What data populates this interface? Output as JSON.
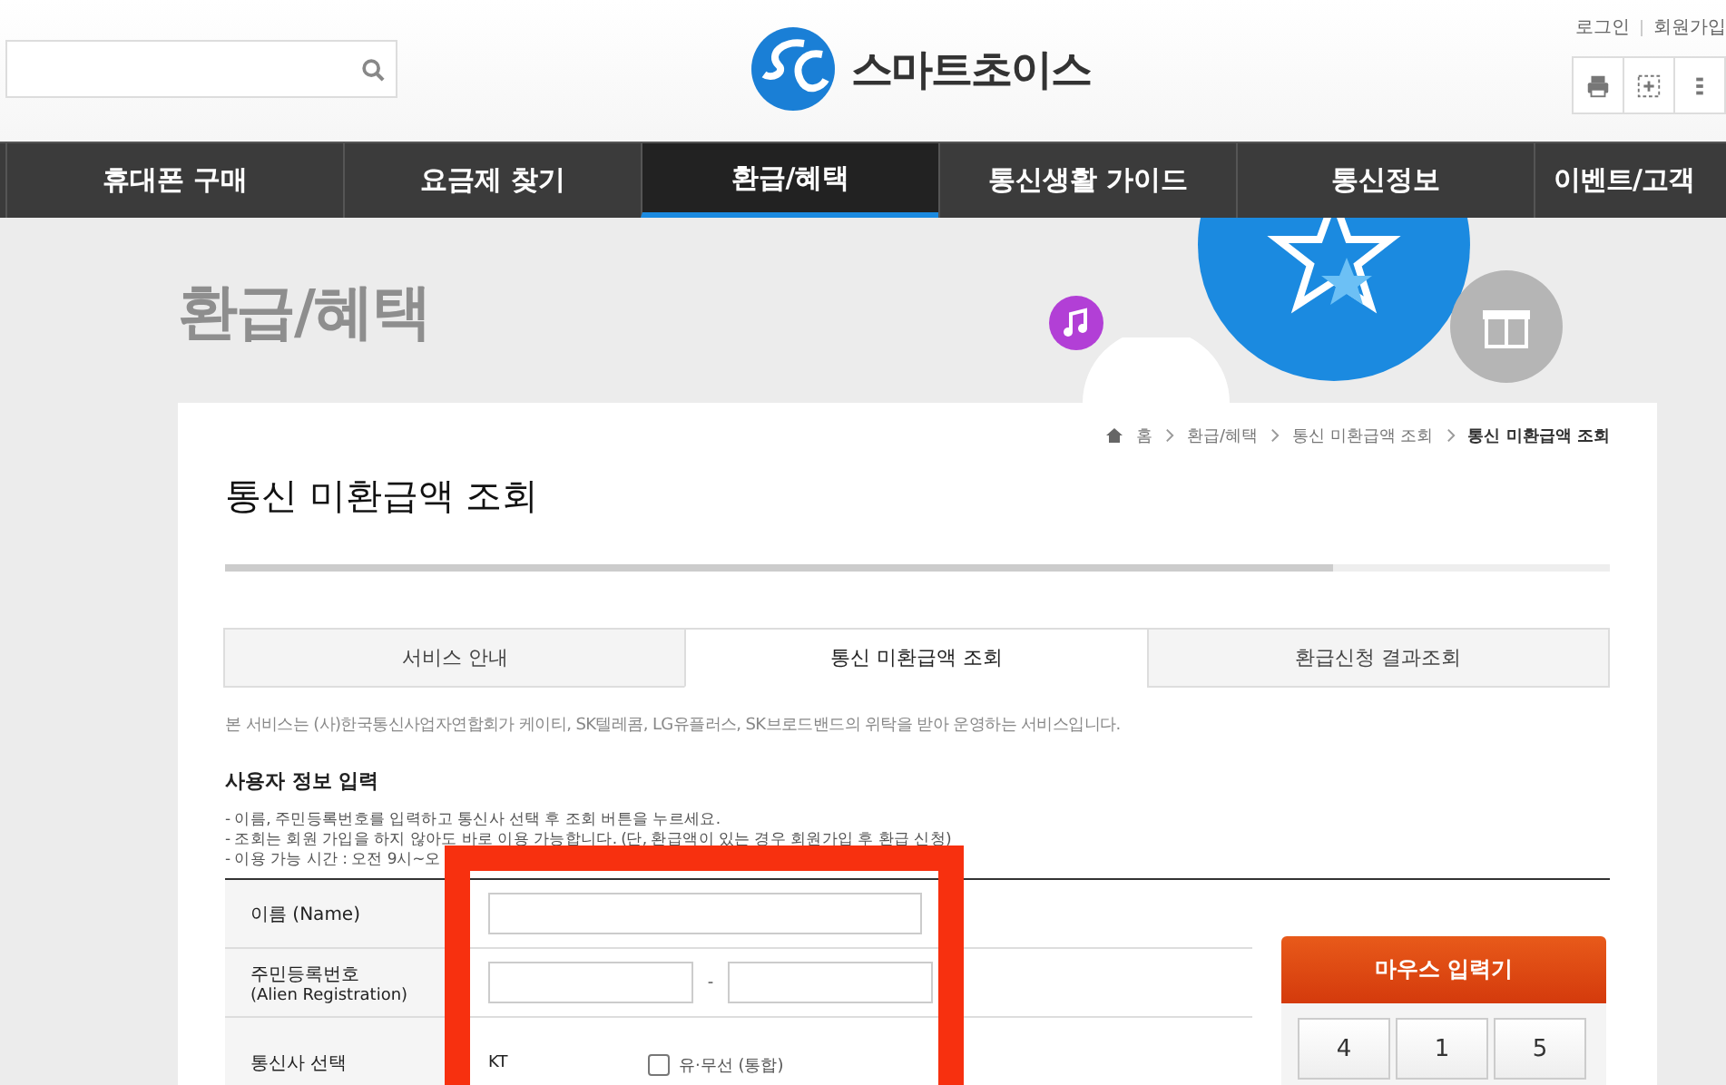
{
  "header": {
    "logo_text": "스마트초이스",
    "links": [
      "로그인",
      "회원가입"
    ]
  },
  "nav": [
    {
      "label": "휴대폰 구매",
      "selected": false
    },
    {
      "label": "요금제 찾기",
      "selected": false
    },
    {
      "label": "환급/혜택",
      "selected": true
    },
    {
      "label": "통신생활 가이드",
      "selected": false
    },
    {
      "label": "통신정보",
      "selected": false
    },
    {
      "label": "이벤트/고객",
      "selected": false
    }
  ],
  "banner": {
    "title": "환급/혜택"
  },
  "breadcrumb": [
    "홈",
    "환급/혜택",
    "통신 미환급액 조회",
    "통신 미환급액 조회"
  ],
  "page_title": "통신 미환급액 조회",
  "tabs": [
    {
      "label": "서비스 안내",
      "selected": false
    },
    {
      "label": "통신 미환급액 조회",
      "selected": true
    },
    {
      "label": "환급신청 결과조회",
      "selected": false
    }
  ],
  "intro": "본 서비스는 (사)한국통신사업자연합회가 케이티, SK텔레콤, LG유플러스, SK브로드밴드의 위탁을 받아 운영하는 서비스입니다.",
  "section_title": "사용자 정보 입력",
  "notes": [
    "- 이름, 주민등록번호를 입력하고 통신사 선택 후 조회 버튼을 누르세요.",
    "- 조회는 회원 가입을 하지 않아도 바로 이용 가능합니다. (단, 환급액이 있는 경우 회원가입 후 환급 신청)",
    "- 이용 가능 시간 : 오전 9시~오"
  ],
  "form": [
    {
      "kind": "text",
      "label": "이름 (Name)"
    },
    {
      "kind": "split",
      "label": "주민등록번호",
      "sublabel": "(Alien Registration)",
      "separator": "-"
    },
    {
      "kind": "carrier",
      "label": "통신사 선택",
      "carrier": "KT",
      "option": "유·무선 (통합)",
      "checked": false
    }
  ],
  "keypad": {
    "title": "마우스 입력기",
    "keys": [
      "4",
      "1",
      "5"
    ]
  }
}
